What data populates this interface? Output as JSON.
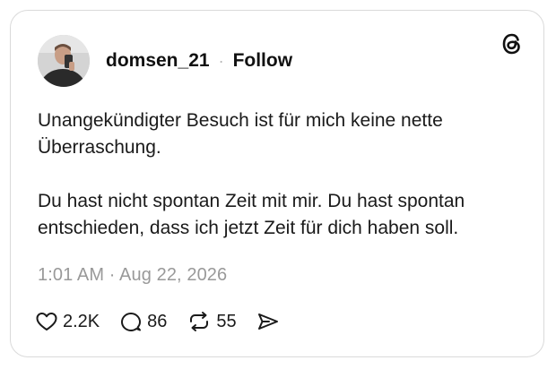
{
  "post": {
    "username": "domsen_21",
    "separator": "·",
    "follow_label": "Follow",
    "paragraphs": [
      "Unangekündigter Besuch ist für mich keine nette Überraschung.",
      "Du hast nicht spontan Zeit mit mir. Du hast spontan entschieden, dass ich jetzt Zeit für dich haben soll."
    ],
    "timestamp": "1:01 AM · Aug 22, 2026",
    "stats": {
      "likes": "2.2K",
      "replies": "86",
      "reposts": "55"
    }
  },
  "icons": {
    "logo": "threads-logo-icon",
    "like": "heart-icon",
    "reply": "comment-icon",
    "repost": "repost-icon",
    "share": "send-icon"
  }
}
